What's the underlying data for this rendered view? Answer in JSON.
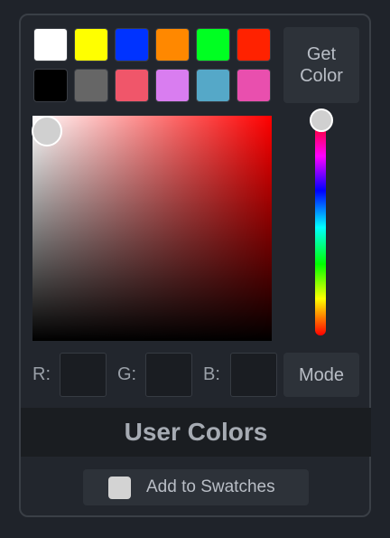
{
  "swatches": [
    {
      "color": "#ffffff",
      "name": "white"
    },
    {
      "color": "#ffff00",
      "name": "yellow"
    },
    {
      "color": "#0033ff",
      "name": "blue"
    },
    {
      "color": "#ff8800",
      "name": "orange"
    },
    {
      "color": "#00ff22",
      "name": "green"
    },
    {
      "color": "#ff2200",
      "name": "red"
    },
    {
      "color": "#000000",
      "name": "black"
    },
    {
      "color": "#666666",
      "name": "gray"
    },
    {
      "color": "#f0566a",
      "name": "pink-red"
    },
    {
      "color": "#d97df0",
      "name": "violet"
    },
    {
      "color": "#55a8c8",
      "name": "teal"
    },
    {
      "color": "#e94fae",
      "name": "magenta"
    }
  ],
  "get_color_button": {
    "label": "Get Color"
  },
  "picker": {
    "hue_color": "#ff0000",
    "selected_color": "#d0d0d0"
  },
  "rgb": {
    "r_label": "R:",
    "g_label": "G:",
    "b_label": "B:",
    "r_value": "",
    "g_value": "",
    "b_value": ""
  },
  "mode_button": {
    "label": "Mode"
  },
  "user_colors": {
    "title": "User Colors"
  },
  "add_button": {
    "label": "Add to Swatches",
    "chip_color": "#d3d3d3"
  }
}
